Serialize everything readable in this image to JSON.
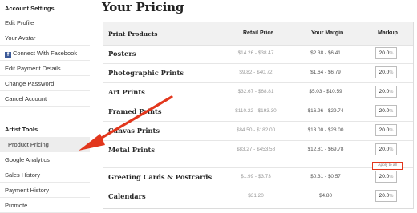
{
  "sidebar": {
    "account_heading": "Account Settings",
    "account_items": [
      "Edit Profile",
      "Your Avatar",
      "Connect With Facebook",
      "Edit Payment Details",
      "Change Password",
      "Cancel Account"
    ],
    "artist_heading": "Artist Tools",
    "artist_items": [
      "Product Pricing",
      "Google Analytics",
      "Sales History",
      "Payment History",
      "Promote"
    ],
    "active_item": "Product Pricing"
  },
  "page": {
    "title": "Your Pricing"
  },
  "table": {
    "headers": {
      "product": "Print Products",
      "retail": "Retail Price",
      "margin": "Your Margin",
      "markup": "Markup"
    },
    "rows": [
      {
        "name": "Posters",
        "retail": "$14.26 - $38.47",
        "margin": "$2.38 - $6.41",
        "markup": "20.0",
        "unit": "%"
      },
      {
        "name": "Photographic Prints",
        "retail": "$9.82 - $40.72",
        "margin": "$1.64 - $6.79",
        "markup": "20.0",
        "unit": "%"
      },
      {
        "name": "Art Prints",
        "retail": "$32.67 - $68.81",
        "margin": "$5.03 - $10.59",
        "markup": "20.0",
        "unit": "%"
      },
      {
        "name": "Framed Prints",
        "retail": "$110.22 - $193.30",
        "margin": "$16.96 - $29.74",
        "markup": "20.0",
        "unit": "%"
      },
      {
        "name": "Canvas Prints",
        "retail": "$84.50 - $182.00",
        "margin": "$13.00 - $28.00",
        "markup": "20.0",
        "unit": "%"
      },
      {
        "name": "Metal Prints",
        "retail": "$83.27 - $453.58",
        "margin": "$12.81 - $69.78",
        "markup": "20.0",
        "unit": "%"
      },
      {
        "name": "Greeting Cards & Postcards",
        "retail": "$1.99 - $3.73",
        "margin": "$0.31 - $0.57",
        "markup": "20.0",
        "unit": "%"
      },
      {
        "name": "Calendars",
        "retail": "$31.20",
        "margin": "$4.80",
        "markup": "20.0",
        "unit": "%"
      }
    ],
    "apply_to_all_label": "Apply to all"
  },
  "annotation": {
    "arrow_color": "#e2371d",
    "highlight_color": "#e2371d"
  },
  "colors": {
    "facebook": "#3b5998",
    "active_bg": "#ededed",
    "header_bg": "#f1f1f1"
  }
}
